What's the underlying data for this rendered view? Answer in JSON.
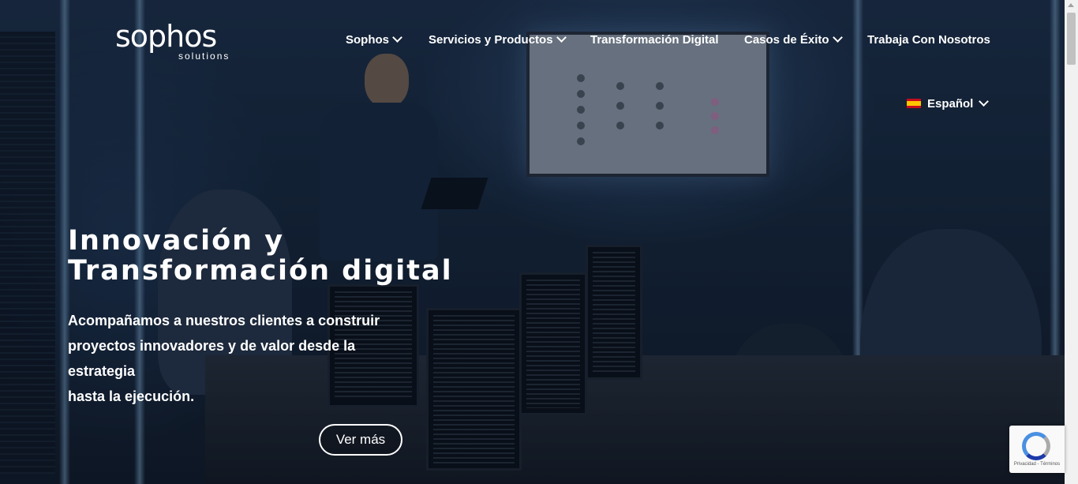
{
  "header": {
    "logo": {
      "brand": "sophos",
      "tagline": "solutions"
    },
    "nav": [
      {
        "label": "Sophos",
        "has_dropdown": true
      },
      {
        "label": "Servicios y Productos",
        "has_dropdown": true
      },
      {
        "label": "Transformación Digital",
        "has_dropdown": false
      },
      {
        "label": "Casos de Éxito",
        "has_dropdown": true
      },
      {
        "label": "Trabaja Con Nosotros",
        "has_dropdown": false
      }
    ],
    "language": {
      "label": "Español",
      "flag_icon": "spain-flag-icon"
    }
  },
  "hero": {
    "title_line1": "Innovación y",
    "title_line2": "Transformación digital",
    "subtitle_line1": "Acompañamos a nuestros clientes a construir",
    "subtitle_line2": "proyectos innovadores y de valor desde la estrategia",
    "subtitle_line3": "hasta la ejecución.",
    "cta_label": "Ver más"
  },
  "recaptcha": {
    "text": "Privacidad - Términos"
  },
  "colors": {
    "text": "#ffffff",
    "background": "#182a40",
    "accent_light": "#96c8f0"
  }
}
